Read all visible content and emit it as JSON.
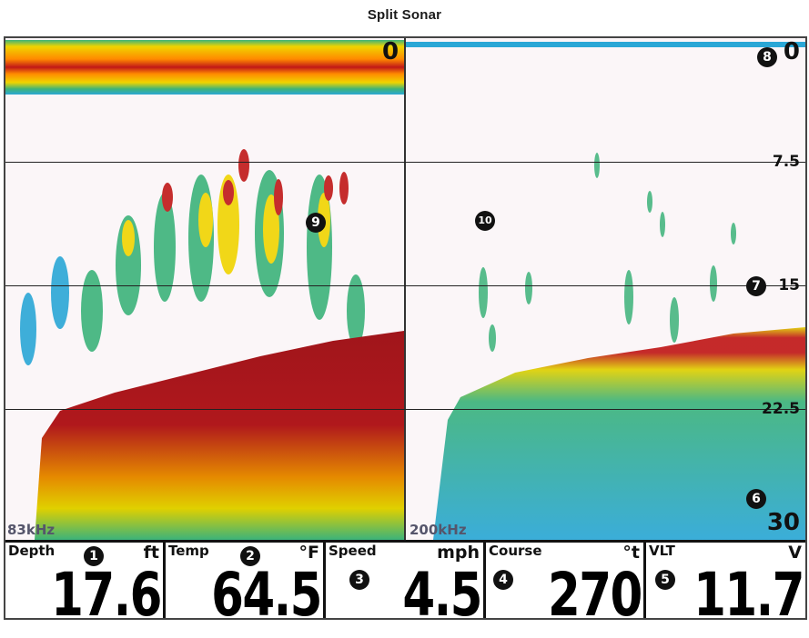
{
  "title": "Split Sonar",
  "depth_scale": {
    "top": "0",
    "marks": [
      "7.5",
      "15",
      "22.5"
    ],
    "bottom": "30"
  },
  "left_pane": {
    "frequency": "83kHz"
  },
  "right_pane": {
    "frequency": "200kHz"
  },
  "callouts": [
    "1",
    "2",
    "3",
    "4",
    "5",
    "6",
    "7",
    "8",
    "9",
    "10"
  ],
  "readouts": [
    {
      "label": "Depth",
      "unit": "ft",
      "value": "17.6"
    },
    {
      "label": "Temp",
      "unit": "°F",
      "value": "64.5"
    },
    {
      "label": "Speed",
      "unit": "mph",
      "value": "4.5"
    },
    {
      "label": "Course",
      "unit": "°t",
      "value": "270"
    },
    {
      "label": "VLT",
      "unit": "V",
      "value": "11.7"
    }
  ],
  "colors": {
    "strong": "#a0151b",
    "mid": "#f0d400",
    "weak": "#3cb37a",
    "faint": "#2aa7d6"
  }
}
